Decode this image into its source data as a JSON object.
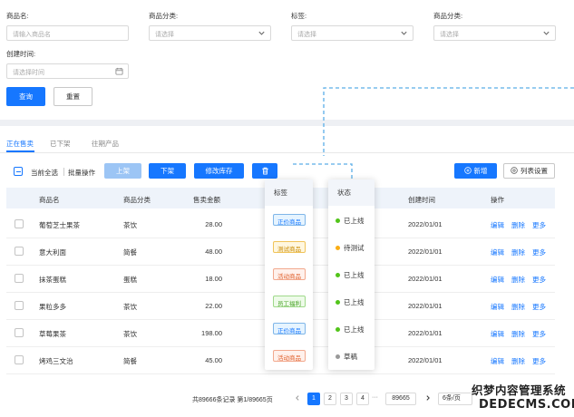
{
  "filters": {
    "product_name_label": "商品名:",
    "product_name_placeholder": "请输入商品名",
    "category_label": "商品分类:",
    "category_placeholder": "请选择",
    "tag_label": "标签:",
    "tag_placeholder": "请选择",
    "category2_label": "商品分类:",
    "category2_placeholder": "请选择",
    "created_label": "创建时间:",
    "created_placeholder": "请选择时间",
    "query_button": "查询",
    "reset_button": "重置"
  },
  "tabs": [
    {
      "label": "正在售卖"
    },
    {
      "label": "已下架"
    },
    {
      "label": "往期产品"
    }
  ],
  "toolbar": {
    "select_all": "当前全选",
    "batch": "批量操作",
    "on_shelf": "上架",
    "off_shelf": "下架",
    "edit_stock": "修改库存",
    "add": "新增",
    "list_settings": "列表设置"
  },
  "columns": {
    "name": "商品名",
    "category": "商品分类",
    "price": "售卖金额",
    "created": "创建时间",
    "actions": "操作"
  },
  "rows": [
    {
      "name": "葡萄芝士果茶",
      "category": "茶饮",
      "price": "28.00",
      "created": "2022/01/01"
    },
    {
      "name": "意大利面",
      "category": "简餐",
      "price": "48.00",
      "created": "2022/01/01"
    },
    {
      "name": "抹茶蛋糕",
      "category": "蛋糕",
      "price": "18.00",
      "created": "2022/01/01"
    },
    {
      "name": "果粒多多",
      "category": "茶饮",
      "price": "22.00",
      "created": "2022/01/01"
    },
    {
      "name": "草莓果茶",
      "category": "茶饮",
      "price": "198.00",
      "created": "2022/01/01"
    },
    {
      "name": "烤鸡三文治",
      "category": "简餐",
      "price": "45.00",
      "created": "2022/01/01"
    }
  ],
  "row_actions": {
    "edit": "编辑",
    "delete": "删除",
    "more": "更多"
  },
  "tag_panel": {
    "title": "标签",
    "tags": [
      {
        "label": "正价商品",
        "bg": "#e6f4ff",
        "border": "#7fb6e8",
        "color": "#1677ff"
      },
      {
        "label": "测试商品",
        "bg": "#fff7e0",
        "border": "#f0c45a",
        "color": "#c98a00"
      },
      {
        "label": "活动商品",
        "bg": "#fff1ec",
        "border": "#f2a98e",
        "color": "#e0602c"
      },
      {
        "label": "员工福利",
        "bg": "#eefbe9",
        "border": "#9fd98a",
        "color": "#4aa329"
      },
      {
        "label": "正价商品",
        "bg": "#e6f4ff",
        "border": "#7fb6e8",
        "color": "#1677ff"
      },
      {
        "label": "活动商品",
        "bg": "#fff1ec",
        "border": "#f2a98e",
        "color": "#e0602c"
      }
    ]
  },
  "status_panel": {
    "title": "状态",
    "items": [
      {
        "label": "已上线",
        "color": "#52c41a"
      },
      {
        "label": "待测试",
        "color": "#faad14"
      },
      {
        "label": "已上线",
        "color": "#52c41a"
      },
      {
        "label": "已上线",
        "color": "#52c41a"
      },
      {
        "label": "已上线",
        "color": "#52c41a"
      },
      {
        "label": "草稿",
        "color": "#999999"
      }
    ]
  },
  "pagination": {
    "summary": "共89666条记录 第1/89665页",
    "pages": [
      "1",
      "2",
      "3",
      "4"
    ],
    "ellipsis": "···",
    "last_page": "89665",
    "page_size": "6条/页"
  },
  "watermark": {
    "cn": "织梦内容管理系统",
    "en": "DEDECMS.COM"
  },
  "colors": {
    "accent": "#1677ff",
    "accent_disabled": "#9cc5f5",
    "header_bg": "#eef3fa",
    "dash": "#5aaee8"
  }
}
